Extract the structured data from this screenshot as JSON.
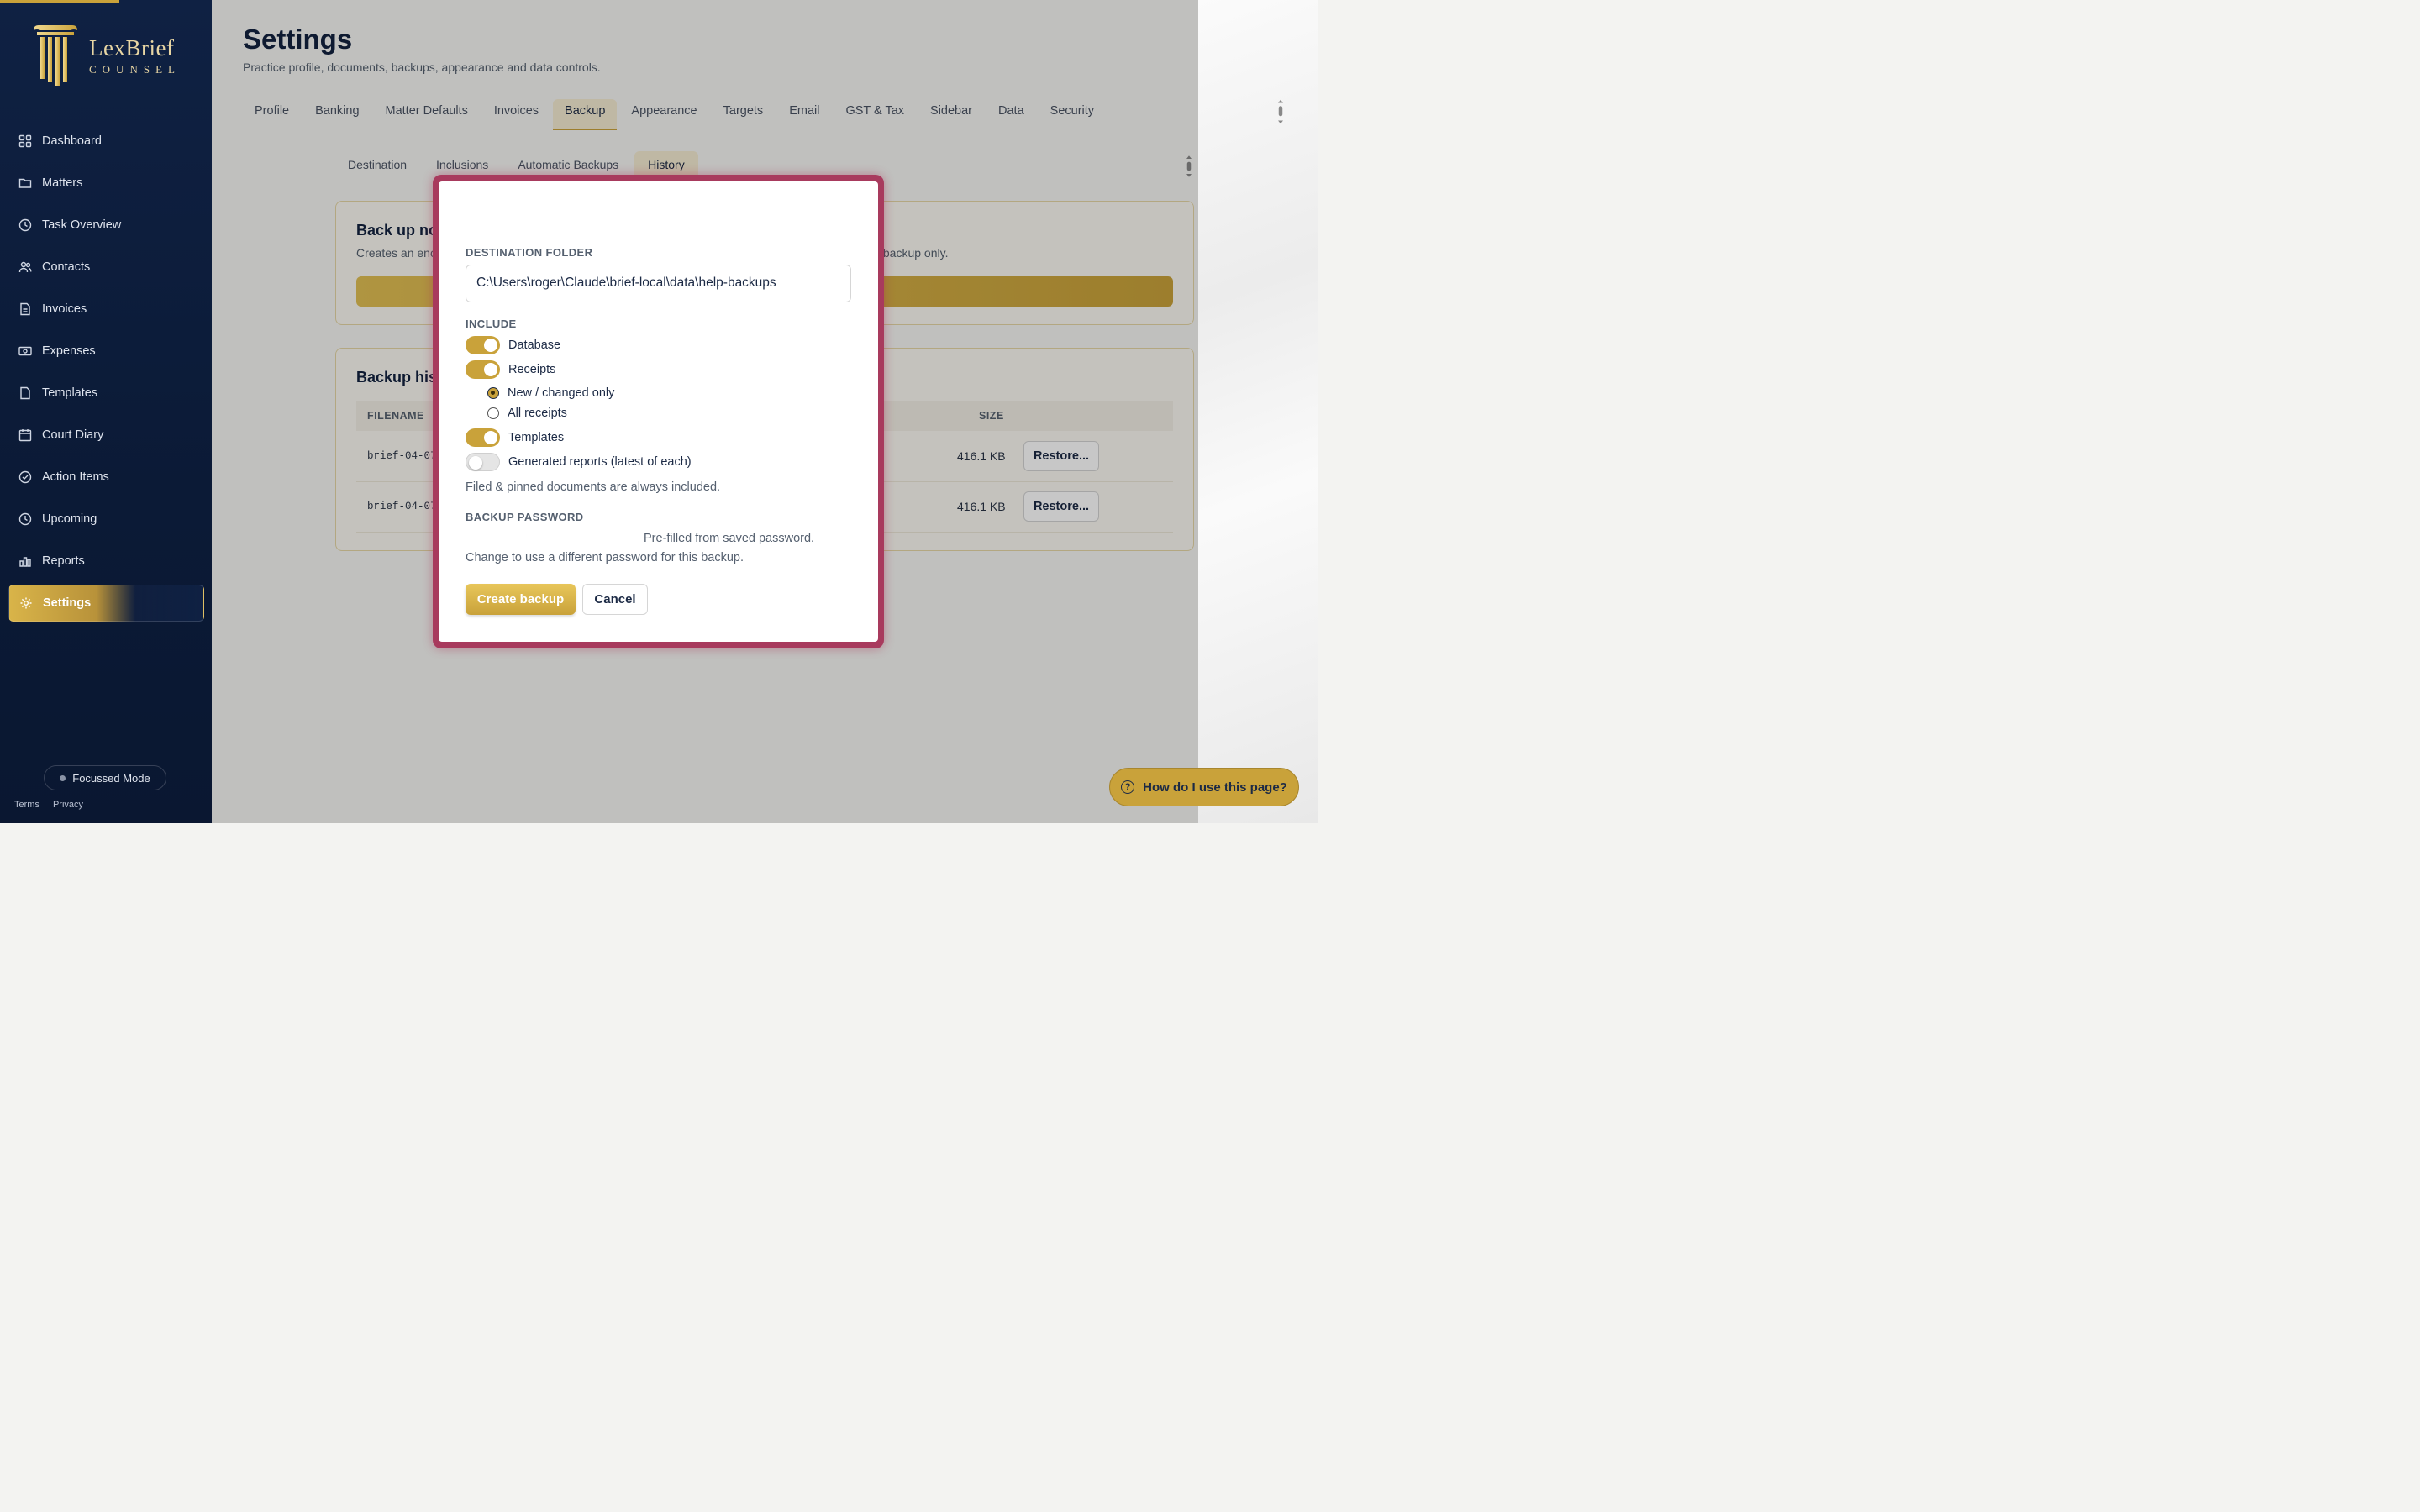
{
  "brand": {
    "name": "LexBrief",
    "tagline": "COUNSEL"
  },
  "sidebar": {
    "items": [
      {
        "label": "Dashboard",
        "icon": "grid-icon"
      },
      {
        "label": "Matters",
        "icon": "folder-icon"
      },
      {
        "label": "Task Overview",
        "icon": "clock-icon"
      },
      {
        "label": "Contacts",
        "icon": "people-icon"
      },
      {
        "label": "Invoices",
        "icon": "document-icon"
      },
      {
        "label": "Expenses",
        "icon": "cash-icon"
      },
      {
        "label": "Templates",
        "icon": "file-icon"
      },
      {
        "label": "Court Diary",
        "icon": "calendar-icon"
      },
      {
        "label": "Action Items",
        "icon": "check-circle-icon"
      },
      {
        "label": "Upcoming",
        "icon": "clock-icon"
      },
      {
        "label": "Reports",
        "icon": "bar-chart-icon"
      },
      {
        "label": "Settings",
        "icon": "gear-icon",
        "active": true
      }
    ],
    "focus_mode": "Focussed Mode",
    "footer_links": [
      "Terms",
      "Privacy"
    ]
  },
  "header": {
    "title": "Settings",
    "subtitle": "Practice profile, documents, backups, appearance and data controls."
  },
  "tabs": [
    "Profile",
    "Banking",
    "Matter Defaults",
    "Invoices",
    "Backup",
    "Appearance",
    "Targets",
    "Email",
    "GST & Tax",
    "Sidebar",
    "Data",
    "Security"
  ],
  "active_tab": "Backup",
  "subtabs": [
    "Destination",
    "Inclusions",
    "Automatic Backups",
    "History"
  ],
  "active_subtab": "History",
  "backup_card": {
    "title": "Back up no",
    "desc_left": "Creates an enc",
    "desc_right": "s backup only."
  },
  "history_card": {
    "title": "Backup hist",
    "columns": {
      "filename": "FILENAME",
      "size": "SIZE"
    },
    "rows": [
      {
        "filename": "brief-04-07-",
        "size": "416.1 KB",
        "action": "Restore..."
      },
      {
        "filename": "brief-04-07-",
        "size": "416.1 KB",
        "action": "Restore..."
      }
    ]
  },
  "modal": {
    "destination_label": "DESTINATION FOLDER",
    "destination_value": "C:\\Users\\roger\\Claude\\brief-local\\data\\help-backups",
    "include_label": "INCLUDE",
    "toggles": [
      {
        "label": "Database",
        "on": true
      },
      {
        "label": "Receipts",
        "on": true
      },
      {
        "label": "Templates",
        "on": true
      },
      {
        "label": "Generated reports (latest of each)",
        "on": false
      }
    ],
    "receipt_options": [
      {
        "label": "New / changed only",
        "selected": true
      },
      {
        "label": "All receipts",
        "selected": false
      }
    ],
    "include_note": "Filed & pinned documents are always included.",
    "password_label": "BACKUP PASSWORD",
    "password_hint": "Pre-filled from saved password.",
    "password_note": "Change to use a different password for this backup.",
    "create_button": "Create backup",
    "cancel_button": "Cancel"
  },
  "help_button": "How do I use this page?",
  "colors": {
    "accent": "#c9a23a",
    "sidebar": "#0f2143",
    "modal_border": "#a83a5d"
  }
}
